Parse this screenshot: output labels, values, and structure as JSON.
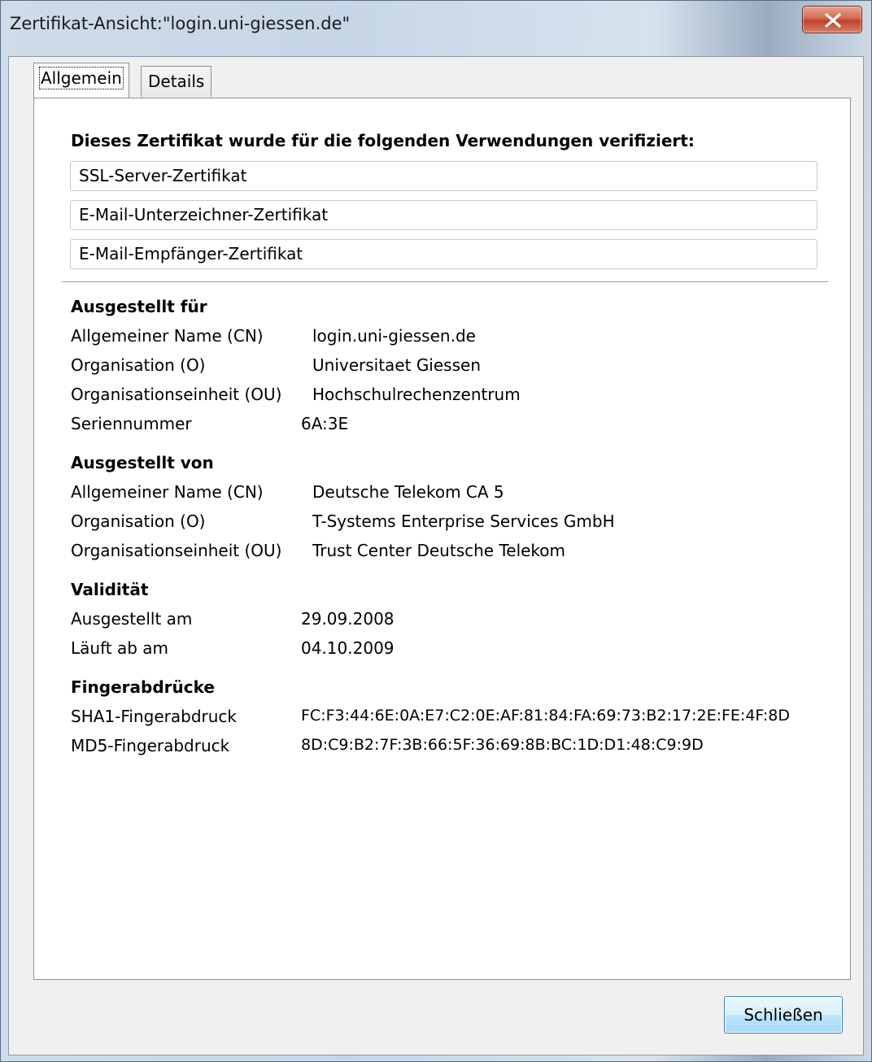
{
  "window": {
    "title": "Zertifikat-Ansicht:\"login.uni-giessen.de\""
  },
  "tabs": [
    {
      "label": "Allgemein",
      "active": true
    },
    {
      "label": "Details",
      "active": false
    }
  ],
  "usage": {
    "heading": "Dieses Zertifikat wurde für die folgenden Verwendungen verifiziert:",
    "items": [
      "SSL-Server-Zertifikat",
      "E-Mail-Unterzeichner-Zertifikat",
      "E-Mail-Empfänger-Zertifikat"
    ]
  },
  "issued_to": {
    "title": "Ausgestellt für",
    "rows": [
      {
        "label": "Allgemeiner Name (CN)",
        "value": "login.uni-giessen.de"
      },
      {
        "label": "Organisation (O)",
        "value": "Universitaet Giessen"
      },
      {
        "label": "Organisationseinheit (OU)",
        "value": "Hochschulrechenzentrum"
      },
      {
        "label": "Seriennummer",
        "value": "6A:3E"
      }
    ]
  },
  "issued_by": {
    "title": "Ausgestellt von",
    "rows": [
      {
        "label": "Allgemeiner Name (CN)",
        "value": "Deutsche Telekom CA 5"
      },
      {
        "label": "Organisation (O)",
        "value": "T-Systems Enterprise Services GmbH"
      },
      {
        "label": "Organisationseinheit (OU)",
        "value": "Trust Center Deutsche Telekom"
      }
    ]
  },
  "validity": {
    "title": "Validität",
    "rows": [
      {
        "label": "Ausgestellt am",
        "value": "29.09.2008"
      },
      {
        "label": "Läuft ab am",
        "value": "04.10.2009"
      }
    ]
  },
  "fingerprints": {
    "title": "Fingerabdrücke",
    "rows": [
      {
        "label": "SHA1-Fingerabdruck",
        "value": "FC:F3:44:6E:0A:E7:C2:0E:AF:81:84:FA:69:73:B2:17:2E:FE:4F:8D"
      },
      {
        "label": "MD5-Fingerabdruck",
        "value": "8D:C9:B2:7F:3B:66:5F:36:69:8B:BC:1D:D1:48:C9:9D"
      }
    ]
  },
  "buttons": {
    "close_label": "Schließen",
    "window_close_icon": "close-x-icon"
  }
}
